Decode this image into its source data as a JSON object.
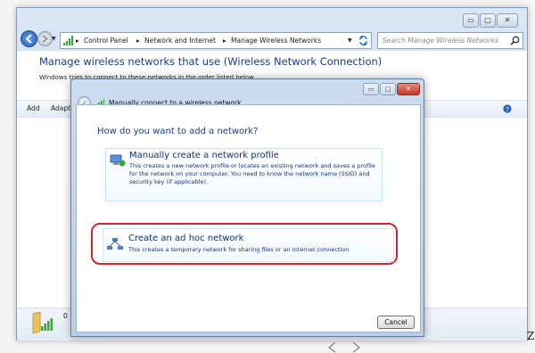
{
  "window": {
    "controls": {
      "minimize": "▭",
      "maximize": "□",
      "close": "✕"
    },
    "address": {
      "part1": "Control Panel",
      "part2": "Network and Internet",
      "part3": "Manage Wireless Networks"
    },
    "search_placeholder": "Search Manage Wireless Networks",
    "title": "Manage wireless networks that use (Wireless Network Connection)",
    "subtitle": "Windows tries to connect to these networks in the order listed below.",
    "toolbar": {
      "add": "Add",
      "adapter": "Adapt"
    },
    "status_count": "0"
  },
  "dialog": {
    "title": "Manually connect to a wireless network",
    "question": "How do you want to add a network?",
    "options": [
      {
        "title": "Manually create a network profile",
        "desc": "This creates a new network profile or locates an existing network and saves a profile for the network on your computer. You need to know the network name (SSID) and security key (if applicable)."
      },
      {
        "title": "Create an ad hoc network",
        "desc": "This creates a temporary network for sharing files or an Internet connection"
      }
    ],
    "cancel_label": "Cancel"
  },
  "stray_char": "Z",
  "colors": {
    "highlight": "#d0282c",
    "link": "#1e3b8a"
  }
}
